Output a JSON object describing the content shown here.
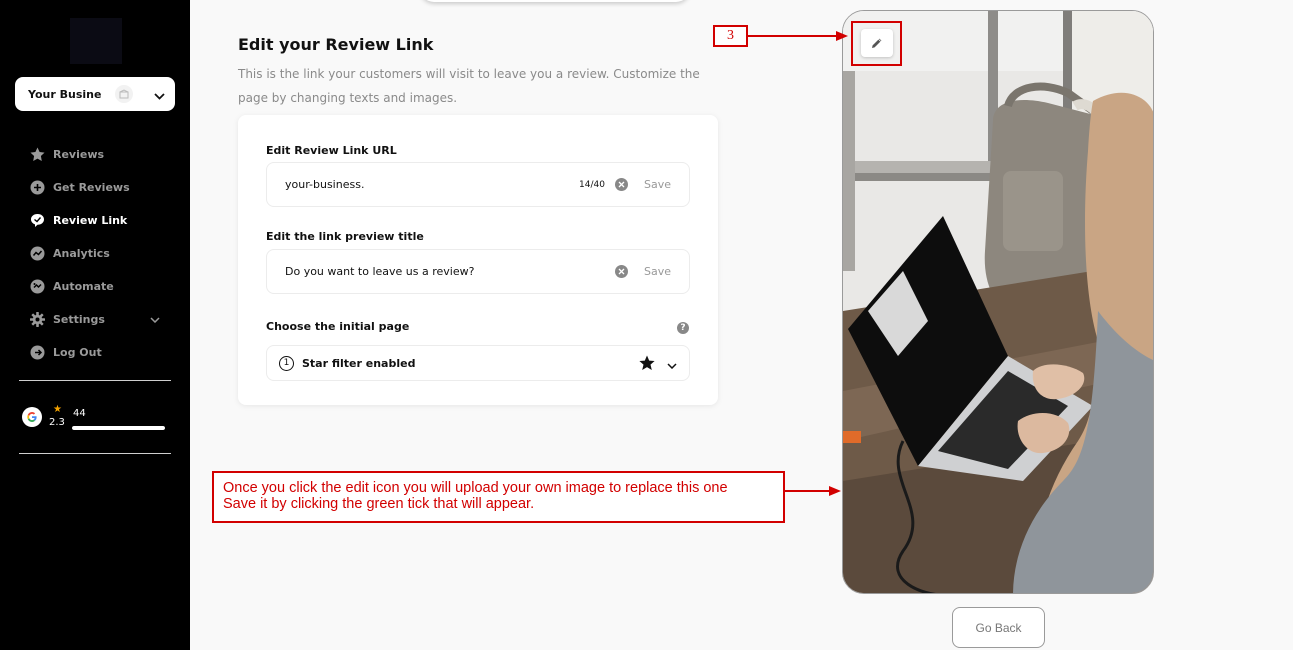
{
  "sidebar": {
    "business_name": "Your Business",
    "items": [
      {
        "label": "Reviews",
        "icon": "star-badge-icon"
      },
      {
        "label": "Get Reviews",
        "icon": "plus-circle-icon"
      },
      {
        "label": "Review Link",
        "icon": "chat-bubble-icon"
      },
      {
        "label": "Analytics",
        "icon": "chart-icon"
      },
      {
        "label": "Automate",
        "icon": "automate-icon"
      },
      {
        "label": "Settings",
        "icon": "gear-icon"
      },
      {
        "label": "Log Out",
        "icon": "logout-icon"
      }
    ],
    "active_item": "Review Link",
    "rating": {
      "score": "2.3",
      "count": "44",
      "bar_fraction": 1.0
    }
  },
  "main": {
    "title": "Edit your Review Link",
    "description": "This is the link your customers will visit to leave you a review. Customize the page by changing texts and images.",
    "url_field": {
      "label": "Edit Review Link URL",
      "value": "your-business.",
      "counter": "14/40",
      "save_label": "Save"
    },
    "preview_field": {
      "label": "Edit the link preview title",
      "value": "Do you want to leave us a review?",
      "save_label": "Save"
    },
    "initial_page": {
      "label": "Choose the initial page",
      "help": "?",
      "step": "1",
      "selected": "Star filter enabled"
    }
  },
  "annotations": {
    "step_number": "3",
    "note_line1": "Once you click the edit icon you will upload your own image to replace this one",
    "note_line2": "Save it by clicking the green tick that will appear.",
    "color": "#d20000"
  },
  "preview": {
    "go_back_label": "Go Back"
  },
  "colors": {
    "sidebar_bg": "#000000",
    "page_bg": "#f9f9f9",
    "annotation": "#d20000",
    "rating_star": "#f4a300"
  }
}
